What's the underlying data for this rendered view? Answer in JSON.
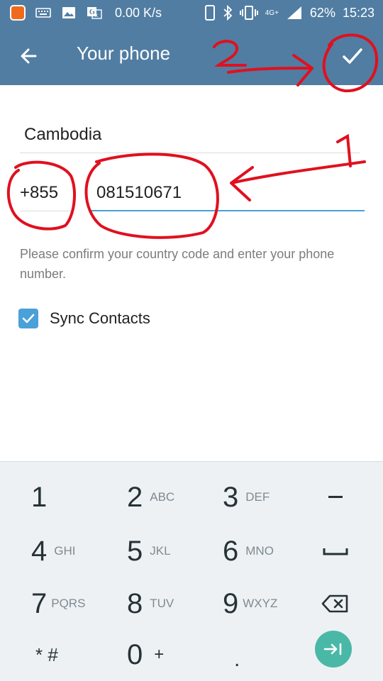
{
  "status_bar": {
    "speed": "0.00 K/s",
    "network": "4G+",
    "battery": "62%",
    "time": "15:23",
    "icons": [
      "app-icon",
      "keyboard-icon",
      "image-icon",
      "translate-icon",
      "phone-icon",
      "bluetooth-icon",
      "vibrate-icon",
      "signal-icon"
    ]
  },
  "app_bar": {
    "title": "Your phone",
    "back_icon": "arrow-left-icon",
    "done_icon": "checkmark-icon",
    "color": "#517da2"
  },
  "form": {
    "country": "Cambodia",
    "country_code": "+855",
    "phone_number": "081510671",
    "hint": "Please confirm your country code and enter your phone number.",
    "sync_contacts": {
      "label": "Sync Contacts",
      "checked": true
    },
    "accent": "#4aa0d8"
  },
  "annotations": {
    "step1": "1",
    "step2": "2",
    "color": "#e0101f"
  },
  "keypad": {
    "keys": [
      {
        "num": "1",
        "letters": ""
      },
      {
        "num": "2",
        "letters": "ABC"
      },
      {
        "num": "3",
        "letters": "DEF"
      },
      {
        "num": "4",
        "letters": "GHI"
      },
      {
        "num": "5",
        "letters": "JKL"
      },
      {
        "num": "6",
        "letters": "MNO"
      },
      {
        "num": "7",
        "letters": "PQRS"
      },
      {
        "num": "8",
        "letters": "TUV"
      },
      {
        "num": "9",
        "letters": "WXYZ"
      },
      {
        "num": "* #",
        "letters": ""
      },
      {
        "num": "0",
        "letters": "+"
      },
      {
        "num": ".",
        "letters": ""
      }
    ],
    "fn_keys": [
      "minus-icon",
      "space-icon",
      "backspace-icon",
      "next-icon"
    ],
    "go_color": "#4ab8a7"
  }
}
